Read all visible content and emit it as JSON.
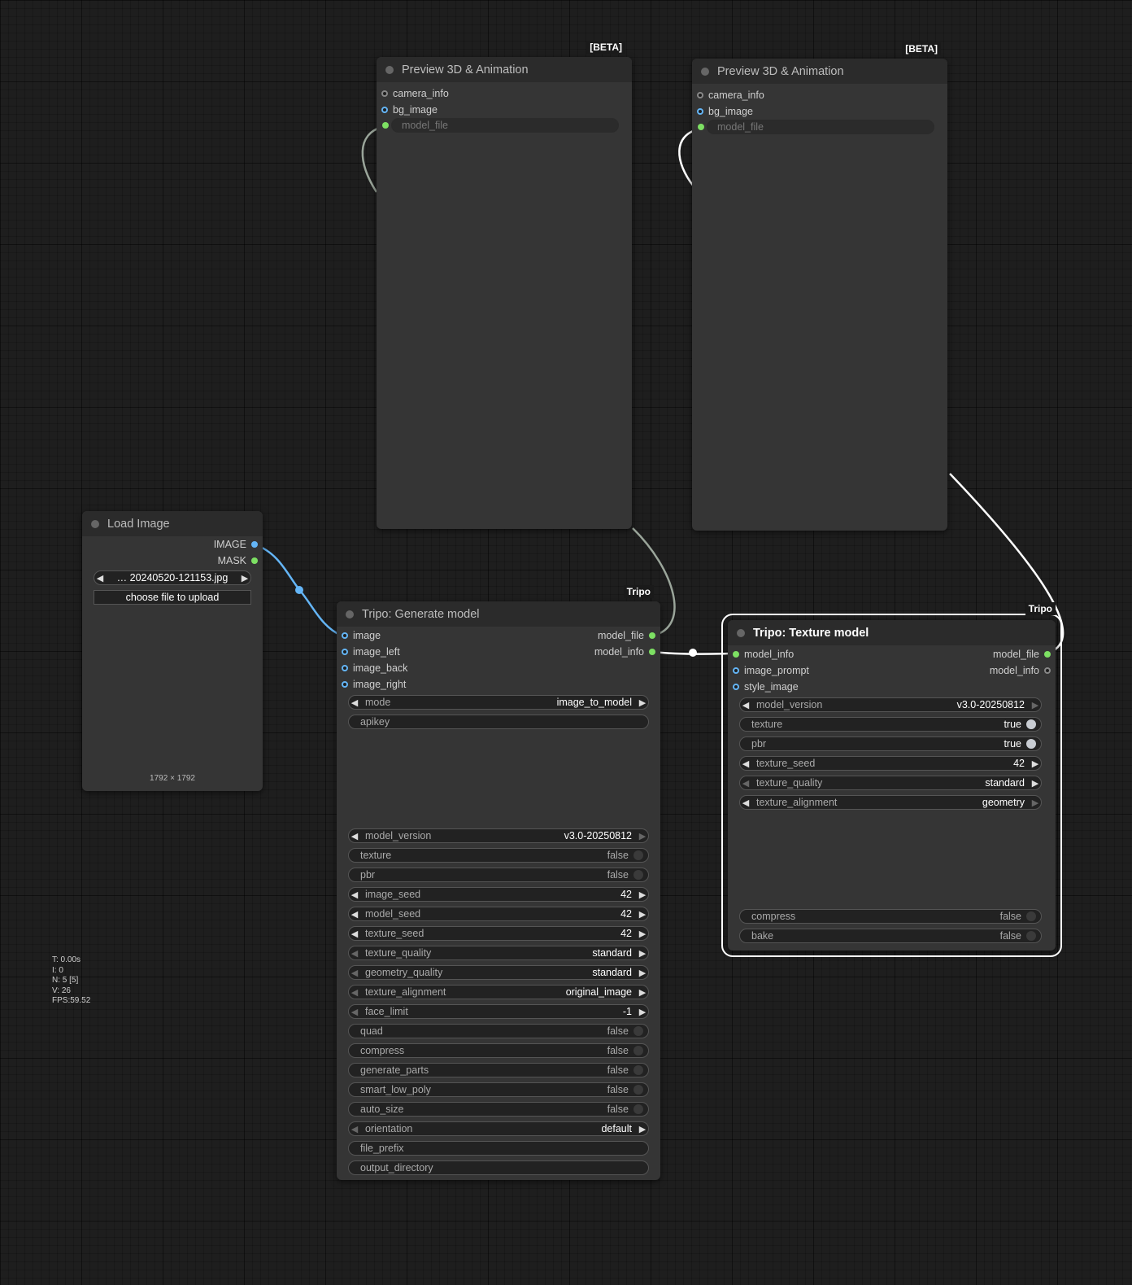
{
  "nodes": {
    "load_image": {
      "title": "Load Image",
      "outputs": [
        "IMAGE",
        "MASK"
      ],
      "image_combo": "… 20240520-121153.jpg",
      "upload_label": "choose file to upload",
      "image_size": "1792 × 1792"
    },
    "preview1": {
      "badge": "[BETA]",
      "title": "Preview 3D & Animation",
      "inputs": [
        "camera_info",
        "bg_image",
        "model_file"
      ]
    },
    "preview2": {
      "badge": "[BETA]",
      "title": "Preview 3D & Animation",
      "inputs": [
        "camera_info",
        "bg_image",
        "model_file"
      ]
    },
    "generate": {
      "badge": "Tripo",
      "title": "Tripo: Generate model",
      "inputs": [
        "image",
        "image_left",
        "image_back",
        "image_right"
      ],
      "outputs": [
        "model_file",
        "model_info"
      ],
      "widgets": {
        "mode": {
          "label": "mode",
          "value": "image_to_model"
        },
        "apikey": {
          "label": "apikey",
          "value": ""
        },
        "model_version": {
          "label": "model_version",
          "value": "v3.0-20250812"
        },
        "texture": {
          "label": "texture",
          "value": "false"
        },
        "pbr": {
          "label": "pbr",
          "value": "false"
        },
        "image_seed": {
          "label": "image_seed",
          "value": "42"
        },
        "model_seed": {
          "label": "model_seed",
          "value": "42"
        },
        "texture_seed": {
          "label": "texture_seed",
          "value": "42"
        },
        "texture_quality": {
          "label": "texture_quality",
          "value": "standard"
        },
        "geometry_quality": {
          "label": "geometry_quality",
          "value": "standard"
        },
        "texture_alignment": {
          "label": "texture_alignment",
          "value": "original_image"
        },
        "face_limit": {
          "label": "face_limit",
          "value": "-1"
        },
        "quad": {
          "label": "quad",
          "value": "false"
        },
        "compress": {
          "label": "compress",
          "value": "false"
        },
        "generate_parts": {
          "label": "generate_parts",
          "value": "false"
        },
        "smart_low_poly": {
          "label": "smart_low_poly",
          "value": "false"
        },
        "auto_size": {
          "label": "auto_size",
          "value": "false"
        },
        "orientation": {
          "label": "orientation",
          "value": "default"
        },
        "file_prefix": {
          "label": "file_prefix",
          "value": ""
        },
        "output_directory": {
          "label": "output_directory",
          "value": ""
        }
      }
    },
    "texture": {
      "badge": "Tripo",
      "title": "Tripo: Texture model",
      "inputs": [
        "model_info",
        "image_prompt",
        "style_image"
      ],
      "outputs": [
        "model_file",
        "model_info"
      ],
      "widgets": {
        "model_version": {
          "label": "model_version",
          "value": "v3.0-20250812"
        },
        "texture": {
          "label": "texture",
          "value": "true"
        },
        "pbr": {
          "label": "pbr",
          "value": "true"
        },
        "texture_seed": {
          "label": "texture_seed",
          "value": "42"
        },
        "texture_quality": {
          "label": "texture_quality",
          "value": "standard"
        },
        "texture_alignment": {
          "label": "texture_alignment",
          "value": "geometry"
        },
        "compress": {
          "label": "compress",
          "value": "false"
        },
        "bake": {
          "label": "bake",
          "value": "false"
        }
      }
    }
  },
  "stats": [
    "T: 0.00s",
    "I: 0",
    "N: 5 [5]",
    "V: 26",
    "FPS:59.52"
  ],
  "colors": {
    "image_link": "#64b5f6",
    "model_link": "#ffffff",
    "model_link_dim": "#9aa59a",
    "model_slot": "#7de063",
    "image_slot": "#64b5f6"
  }
}
